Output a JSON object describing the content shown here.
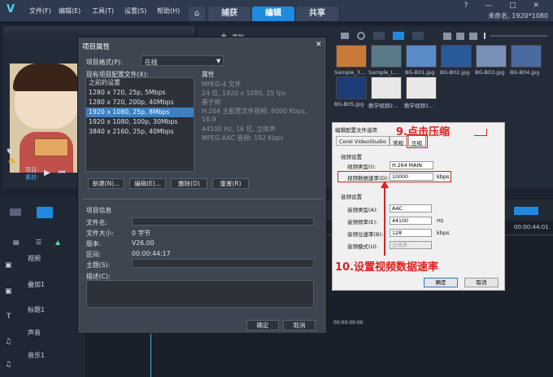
{
  "menubar": {
    "logo": "V",
    "items": [
      "文件(F)",
      "编辑(E)",
      "工具(T)",
      "设置(S)",
      "帮助(H)"
    ],
    "tabs": [
      "捕获",
      "编辑",
      "共享"
    ],
    "active_tab": "编辑",
    "window_controls": "? — □ ✕",
    "project_info": "未命名, 1920*1080"
  },
  "preview": {
    "project_label": "项目-",
    "material_label": "素材-"
  },
  "library": {
    "add_label": "添加",
    "items": [
      {
        "name": "Sample_3...",
        "color": "#c87a3a"
      },
      {
        "name": "Sample_L...",
        "color": "#5a7a8a"
      },
      {
        "name": "BG-B01.jpg",
        "color": "#5a8ac8"
      },
      {
        "name": "BG-B02.jpg",
        "color": "#2a5a9a"
      },
      {
        "name": "BG-B03.jpg",
        "color": "#7a90b8"
      },
      {
        "name": "BG-B04.jpg",
        "color": "#4a6aa0"
      },
      {
        "name": "BG-B05.jpg",
        "color": "#1e3c78"
      },
      {
        "name": "教学视频2...",
        "color": "#e8e8e8"
      },
      {
        "name": "教学视频1...",
        "color": "#e8e8e8"
      }
    ]
  },
  "timeline": {
    "timecode_right": "00:00:44:01",
    "timecode_zero": "00:00:00:00",
    "tracks": [
      "视频",
      "叠加1",
      "标题1",
      "声音",
      "音乐1"
    ]
  },
  "dialog": {
    "title": "项目属性",
    "format_label": "项目格式(P):",
    "format_value": "在线",
    "preset_label": "现有项目配置文件(X):",
    "presets": [
      "之前的设置",
      "1280 x 720, 25p, 5Mbps",
      "1280 x 720, 200p, 40Mbps",
      "1920 x 1080, 25p, 8Mbps",
      "1920 x 1080, 100p, 30Mbps",
      "3840 x 2160, 25p, 40Mbps"
    ],
    "selected_preset": "1920 x 1080, 25p, 8Mbps",
    "properties_label": "属性",
    "properties": [
      "MPEG-4 文件",
      "24 位, 1920 x 1080, 25 fps",
      "基于帧",
      "H.264 主配置文件视频: 8000 Kbps,",
      "16:9",
      "44100 Hz, 16 位, 立体声",
      "MPEG AAC 音频: 192 Kbps"
    ],
    "buttons": {
      "new": "新建(N)...",
      "edit": "编辑(E)...",
      "delete": "删除(D)",
      "reset": "重置(R)",
      "ok": "确定",
      "cancel": "取消"
    },
    "info_label": "项目信息",
    "info": {
      "filename_label": "文件名:",
      "filename_value": "",
      "filesize_label": "文件大小:",
      "filesize_value": "0 字节",
      "version_label": "版本:",
      "version_value": "V26.00",
      "duration_label": "区间:",
      "duration_value": "00:00:44:17",
      "subject_label": "主题(S):",
      "subject_value": "",
      "description_label": "描述(C):",
      "description_value": ""
    }
  },
  "profile_dialog": {
    "title": "编辑配置文件选项",
    "tabs": [
      "Corel VideoStudio",
      "常规",
      "压缩"
    ],
    "video_group": "视频设置",
    "video_type_label": "视频类型(I):",
    "video_type_value": "H.264 MAIN",
    "bitrate_label": "视频数据速率(D):",
    "bitrate_value": "10000",
    "bitrate_unit": "kbps",
    "audio_group": "音频设置",
    "audio_type_label": "音频类型(A):",
    "audio_type_value": "AAC",
    "sample_rate_label": "音频频率(E):",
    "sample_rate_value": "44100",
    "sample_rate_unit": "Hz",
    "audio_bitrate_label": "音频位速率(B):",
    "audio_bitrate_value": "128",
    "audio_bitrate_unit": "kbps",
    "audio_mode_label": "音频模式(U):",
    "audio_mode_value": "立体声",
    "ok": "确定",
    "cancel": "取消"
  },
  "annotations": {
    "step9": "9.点击压缩",
    "step10": "10.设置视频数据速率",
    "color": "#e02020"
  }
}
